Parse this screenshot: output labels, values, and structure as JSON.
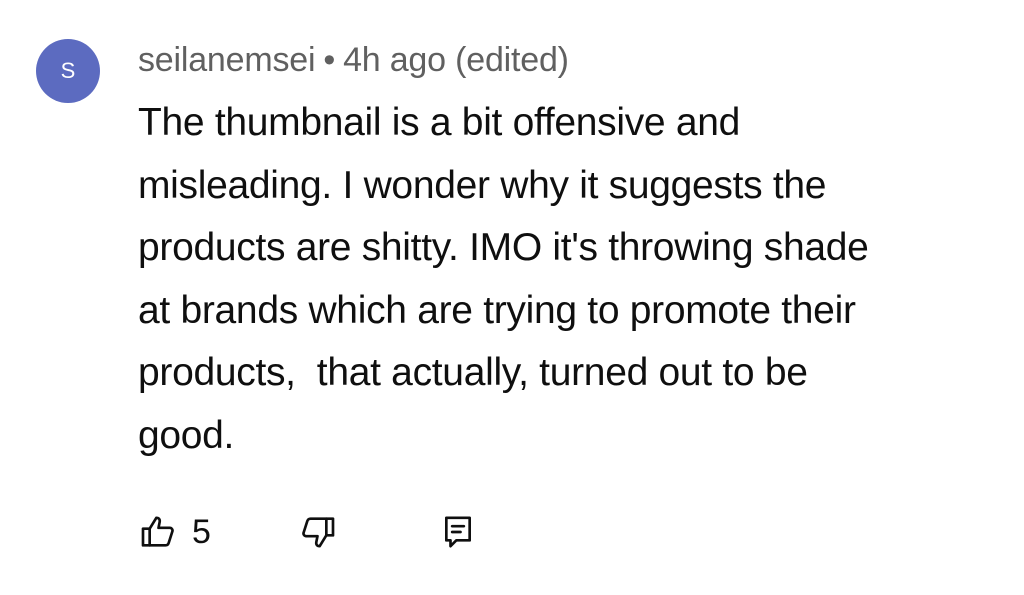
{
  "avatar": {
    "initial": "S",
    "color": "#5c6bc0"
  },
  "comment": {
    "author": "seilanemsei",
    "separator": "•",
    "time": "4h ago",
    "edited": "(edited)",
    "text": "The thumbnail is a bit offensive and\nmisleading. I wonder why it suggests the\nproducts are shitty. IMO it's throwing shade\nat brands which are trying to promote their\nproducts,  that actually, turned out to be\ngood."
  },
  "actions": {
    "like_count": "5",
    "like_icon": "thumbs-up-icon",
    "dislike_icon": "thumbs-down-icon",
    "reply_icon": "reply-icon"
  }
}
